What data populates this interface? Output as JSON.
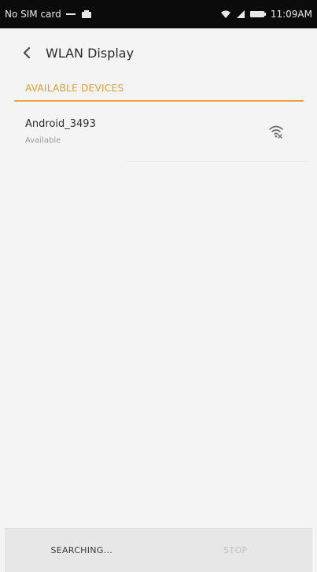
{
  "status_bar": {
    "carrier": "No SIM card",
    "time": "11:09AM",
    "icons": [
      "dash-icon",
      "notification-icon",
      "wifi-icon",
      "signal-icon",
      "battery-icon"
    ]
  },
  "header": {
    "back_icon": "back-arrow-icon",
    "title": "WLAN Display"
  },
  "section": {
    "title": "AVAILABLE DEVICES",
    "accent_color": "#e39b2f"
  },
  "devices": [
    {
      "name": "Android_3493",
      "status": "Available",
      "icon": "wifi-display-icon"
    }
  ],
  "bottom_bar": {
    "left_label": "SEARCHING...",
    "right_label": "STOP"
  }
}
